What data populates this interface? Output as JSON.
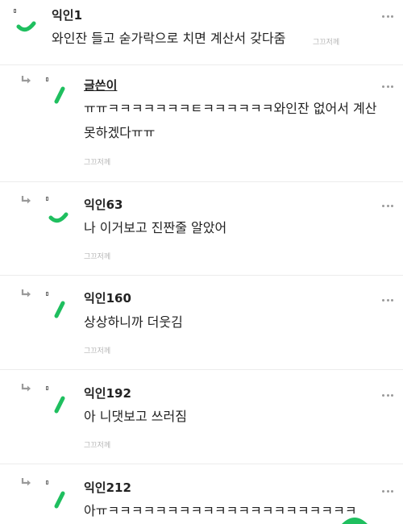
{
  "comments": [
    {
      "name": "익인1",
      "lines": [
        "와인잔 들고 숟가락으로 치면 계산서 갖다줌"
      ],
      "inline_meta": "그끄저께"
    },
    {
      "name": "글쓴이",
      "lines": [
        "ㅠㅠㅋㅋㅋㅋㅋㅋㅋㅌㅋㅋㅋㅋㅋㅋ와인잔 없어서 계산",
        "못하겠다ㅠㅠ"
      ],
      "meta": "그끄저께"
    },
    {
      "name": "익인63",
      "lines": [
        "나 이거보고 진짠줄 알았어"
      ],
      "meta": "그끄저께"
    },
    {
      "name": "익인160",
      "lines": [
        "상상하니까 더웃김"
      ],
      "meta": "그끄저께"
    },
    {
      "name": "익인192",
      "lines": [
        "아 니댓보고 쓰러짐"
      ],
      "meta": "그끄저께"
    },
    {
      "name": "익인212",
      "lines": [
        "아ㅠㅋㅋㅋㅋㅋㅋㅋㅋㅋㅋㅋㅋㅋㅋㅋㅋㅋㅋㅋㅋㅋ"
      ]
    }
  ],
  "colors": {
    "accent": "#1fbf5f",
    "meta": "#b5b5b5",
    "divider": "#ececec"
  },
  "icons": {
    "more": "more-options-icon",
    "reply": "reply-arrow-icon"
  }
}
